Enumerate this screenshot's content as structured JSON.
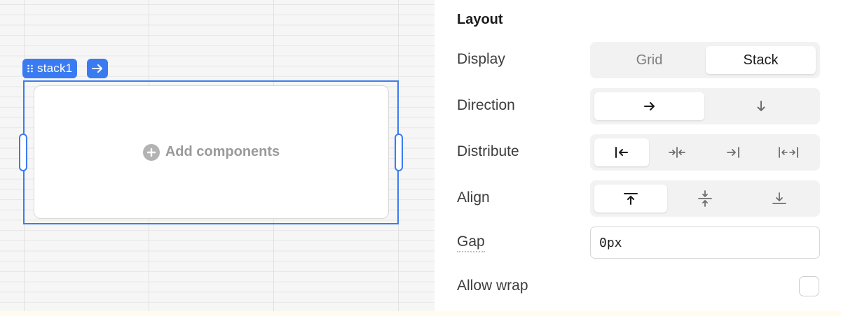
{
  "canvas": {
    "component_name": "stack1",
    "empty_state_label": "Add components"
  },
  "inspector": {
    "section_title": "Layout",
    "display": {
      "label": "Display",
      "options": [
        "Grid",
        "Stack"
      ],
      "selected": "Stack"
    },
    "direction": {
      "label": "Direction",
      "options": [
        "horizontal-arrow-icon",
        "vertical-arrow-icon"
      ],
      "selected": "horizontal-arrow-icon"
    },
    "distribute": {
      "label": "Distribute",
      "options": [
        "distribute-start-icon",
        "distribute-center-icon",
        "distribute-end-icon",
        "distribute-space-between-icon"
      ],
      "selected": "distribute-start-icon"
    },
    "align": {
      "label": "Align",
      "options": [
        "align-top-icon",
        "align-center-icon",
        "align-bottom-icon"
      ],
      "selected": "align-top-icon"
    },
    "gap": {
      "label": "Gap",
      "value": "0px"
    },
    "allow_wrap": {
      "label": "Allow wrap",
      "checked": false
    }
  },
  "colors": {
    "accent": "#3b7bf1",
    "panel_background": "#ffffff",
    "canvas_background": "#f6f6f6"
  }
}
